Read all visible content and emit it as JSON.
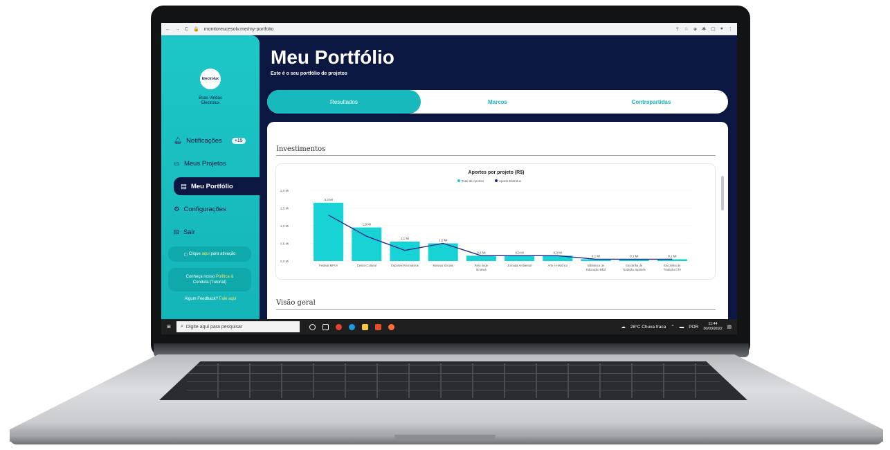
{
  "browser": {
    "url": "monitoreucesolv.me/my-portfolio"
  },
  "sidebar": {
    "logo_text": "Electrolux",
    "brand_line1": "Boas Vindas",
    "brand_line2": "Electrolux",
    "items": [
      {
        "label": "Notificações",
        "icon": "bell-icon",
        "badge": "+15"
      },
      {
        "label": "Meus Projetos",
        "icon": "folder-icon"
      },
      {
        "label": "Meu Portfólio",
        "icon": "portfolio-icon"
      },
      {
        "label": "Configurações",
        "icon": "gear-icon"
      },
      {
        "label": "Sair",
        "icon": "exit-icon"
      }
    ],
    "help_prefix": "Clique",
    "help_link": "aqui",
    "help_suffix": "para ativação",
    "card2_line1": "Conheça nosso",
    "card2_link1": "Política &",
    "card2_link2": "Conduta (Tutorial)",
    "feedback_prefix": "Algum Feedback?",
    "feedback_link": "Fale aqui"
  },
  "header": {
    "title": "Meu Portfólio",
    "subtitle": "Este é o seu portfólio de projetos"
  },
  "tabs": [
    "Resultados",
    "Marcos",
    "Contrapartidas"
  ],
  "sections": {
    "investimentos": "Investimentos",
    "visao_geral": "Visão geral"
  },
  "chart_data": {
    "type": "bar",
    "title": "Aportes por projeto (R$)",
    "legend": [
      "Total de Aportes",
      "Aporte Eletrolux"
    ],
    "legend_position": "top",
    "ylim": [
      0,
      4
    ],
    "y_ticks": [
      "0,0 Mi",
      "0,5 Mi",
      "1,0 Mi",
      "1,5 Mi",
      "2,0 Mi"
    ],
    "categories": [
      "Festival MPVA",
      "Centro Cultural",
      "Esportes Recreativos",
      "Museus Sociais",
      "Para onde 50 anos",
      "Jornada Ambiental",
      "Arte e Histórico",
      "Biblioteca de Educação Bilíd",
      "Escolinha de Tradição Japonês",
      "Escolinha de Tradição CTA"
    ],
    "series": [
      {
        "name": "Total de Aportes",
        "values": [
          3.3,
          1.9,
          1.1,
          1.0,
          0.3,
          0.3,
          0.3,
          0.1,
          0.1,
          0.1
        ]
      },
      {
        "name": "Aporte Eletrolux",
        "values": [
          2.6,
          1.4,
          0.6,
          1.0,
          0.3,
          0.3,
          0.3,
          0.1,
          0.1,
          0.1
        ]
      }
    ],
    "data_labels": [
      "3,3 Mi",
      "1,9 Mi",
      "1,1 Mi",
      "1,0 Mi",
      "0,3 Mi",
      "0,3 Mi",
      "0,3 Mi",
      "0,1 Mi",
      "0,1 Mi",
      "0,1 Mi"
    ],
    "colors": {
      "bar": "#17d3d6",
      "line": "#1d2a8a"
    }
  },
  "taskbar": {
    "search_placeholder": "Digite aqui para pesquisar",
    "weather": "28°C Chuva fraca",
    "lang": "POR",
    "time": "11:44",
    "date": "30/03/2022"
  }
}
